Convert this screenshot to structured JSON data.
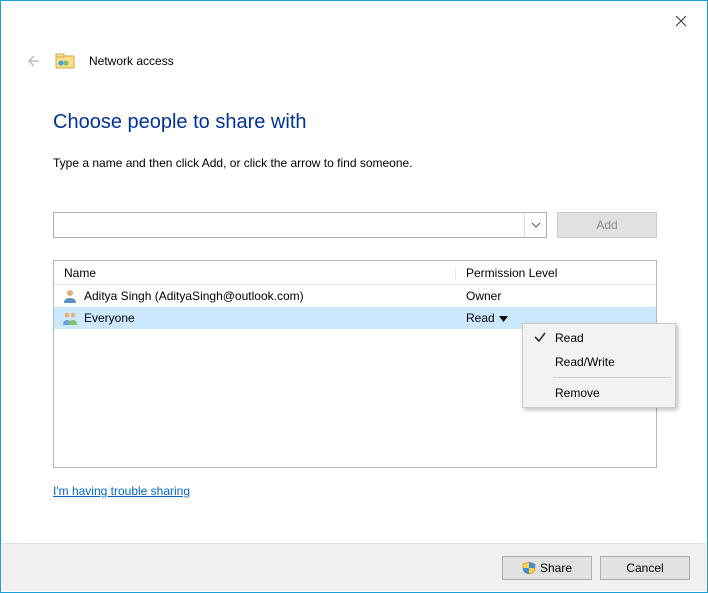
{
  "window": {
    "title": "Network access"
  },
  "page": {
    "heading": "Choose people to share with",
    "subtext": "Type a name and then click Add, or click the arrow to find someone.",
    "trouble_link": "I'm having trouble sharing"
  },
  "add": {
    "input_value": "",
    "button_label": "Add"
  },
  "table": {
    "headers": {
      "name": "Name",
      "perm": "Permission Level"
    },
    "rows": [
      {
        "name": "Aditya Singh (AdityaSingh@outlook.com)",
        "perm": "Owner",
        "selected": false,
        "type": "user"
      },
      {
        "name": "Everyone",
        "perm": "Read",
        "selected": true,
        "type": "group"
      }
    ]
  },
  "dropdown": {
    "items": [
      {
        "label": "Read",
        "checked": true
      },
      {
        "label": "Read/Write",
        "checked": false
      }
    ],
    "remove": "Remove"
  },
  "footer": {
    "share": "Share",
    "cancel": "Cancel"
  }
}
